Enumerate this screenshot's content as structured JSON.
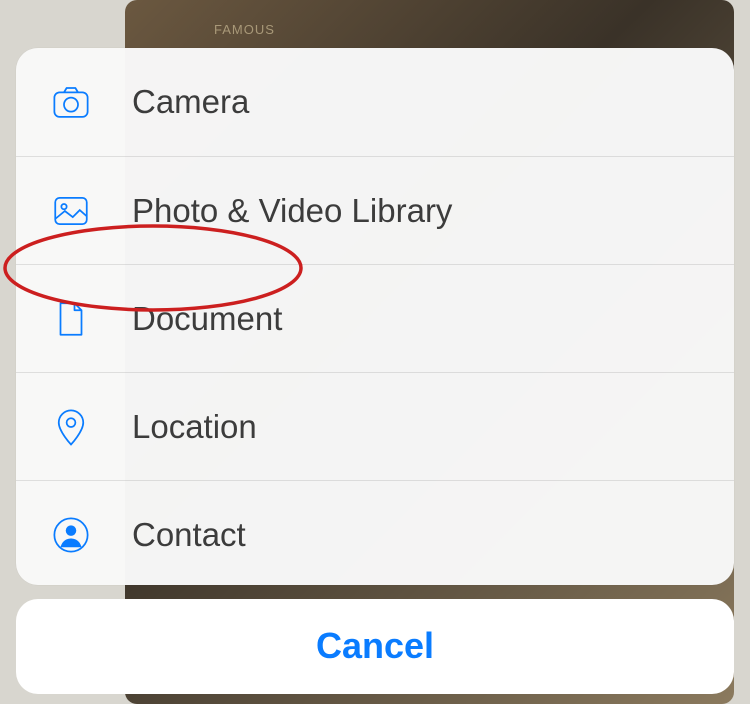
{
  "menu": {
    "items": [
      {
        "id": "camera",
        "label": "Camera"
      },
      {
        "id": "photo-video-library",
        "label": "Photo & Video Library"
      },
      {
        "id": "document",
        "label": "Document"
      },
      {
        "id": "location",
        "label": "Location"
      },
      {
        "id": "contact",
        "label": "Contact"
      }
    ],
    "cancel_label": "Cancel"
  },
  "background": {
    "partial_text": "FAMOUS"
  },
  "annotation": {
    "highlighted_item": "document",
    "shape": "red-oval"
  },
  "colors": {
    "accent": "#0a7cff",
    "text": "#3c3c3c",
    "annotation": "#cc1f1f"
  }
}
